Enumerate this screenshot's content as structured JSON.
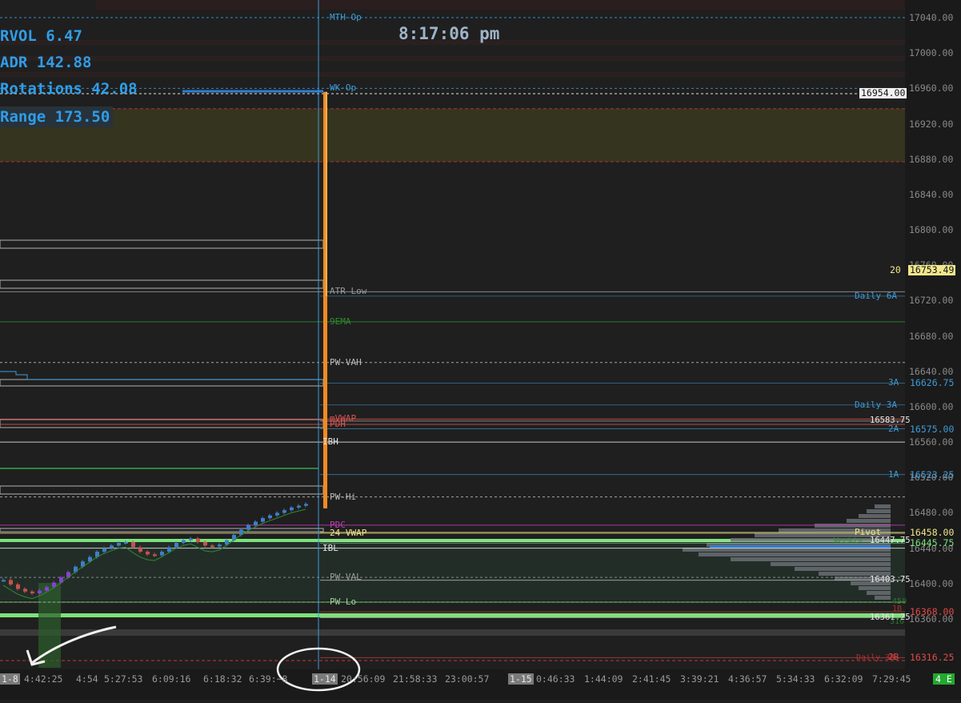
{
  "clock": "8:17:06 pm",
  "stats": [
    "RVOL 6.47",
    "ADR 142.88",
    "Rotations 42.08",
    "Range 173.50"
  ],
  "chart_data": {
    "type": "candlestick",
    "ylim": [
      16300,
      17060
    ],
    "y_ticks": [
      17040,
      17000,
      16960,
      16920,
      16880,
      16840,
      16800,
      16760,
      16720,
      16680,
      16640,
      16600,
      16560,
      16520,
      16480,
      16440,
      16400,
      16360
    ],
    "y_tick_labels": [
      "17040.00",
      "17000.00",
      "16960.00",
      "16920.00",
      "16880.00",
      "16840.00",
      "16800.00",
      "16760.00",
      "16720.00",
      "16680.00",
      "16640.00",
      "16600.00",
      "16560.00",
      "16520.00",
      "16480.00",
      "16440.00",
      "16400.00",
      "16360.00"
    ],
    "x_labels": [
      "1-8",
      "4:42:25",
      "4:54",
      "5:27:53",
      "6:09:16",
      "6:18:32",
      "6:39:~8",
      "1-14",
      "20:56:09",
      "21:58:33",
      "23:00:57",
      "1-15",
      "0:46:33",
      "1:44:09",
      "2:41:45",
      "3:39:21",
      "4:36:57",
      "5:34:33",
      "6:32:09",
      "7:29:45"
    ],
    "x_label_is_date": [
      true,
      false,
      false,
      false,
      false,
      false,
      false,
      true,
      false,
      false,
      false,
      true,
      false,
      false,
      false,
      false,
      false,
      false,
      false,
      false
    ],
    "price_closes": [
      16404,
      16399,
      16394,
      16391,
      16389,
      16392,
      16396,
      16401,
      16407,
      16413,
      16419,
      16425,
      16430,
      16436,
      16440,
      16443,
      16446,
      16447,
      16441,
      16436,
      16433,
      16432,
      16436,
      16441,
      16446,
      16449,
      16451,
      16447,
      16443,
      16442,
      16444,
      16449,
      16455,
      16461,
      16466,
      16470,
      16474,
      16477,
      16480,
      16483,
      16486,
      16488,
      16490
    ],
    "spike": {
      "low": 16485,
      "high": 16956,
      "close": 16725
    },
    "current_price_label": "16954.00",
    "sma_label": "20",
    "sma_value_label": "16753.49",
    "high_zone": [
      16877,
      16937
    ],
    "value_zone": [
      16381,
      16448
    ],
    "levels": [
      {
        "name": "MTH-Op",
        "price": 17040,
        "color": "#3d9bd8",
        "dash": true
      },
      {
        "name": "WK-Op",
        "price": 16960,
        "color": "#3d9bd8",
        "dash": true
      },
      {
        "name": "ATR Low",
        "price": 16730,
        "color": "#9a9a9a",
        "dash": false
      },
      {
        "name": "9EMA",
        "price": 16696,
        "color": "#2e8b2e",
        "dash": false
      },
      {
        "name": "PW-VAH",
        "price": 16650,
        "color": "#bdbdbd",
        "dash": true
      },
      {
        "name": "mVWAP",
        "price": 16586,
        "color": "#d9534f",
        "dash": false
      },
      {
        "name": "PDH",
        "price": 16580,
        "color": "#d9534f",
        "dash": false
      },
      {
        "name": "IBH",
        "price": 16560,
        "color": "#e6e6e6",
        "dash": false
      },
      {
        "name": "PW-Hi",
        "price": 16498,
        "color": "#bdbdbd",
        "dash": true
      },
      {
        "name": "PDC",
        "price": 16466,
        "color": "#c23cb8",
        "dash": false
      },
      {
        "name": "24 VWAP",
        "price": 16457,
        "color": "#f0e68c",
        "dash": false
      },
      {
        "name": "IBL",
        "price": 16440,
        "color": "#e6e6e6",
        "dash": false
      },
      {
        "name": "PW-VAL",
        "price": 16407,
        "color": "#9a9a9a",
        "dash": true
      },
      {
        "name": "PW-Lo",
        "price": 16379,
        "color": "#9bd19b",
        "dash": true
      }
    ],
    "right_levels": [
      {
        "label": "Daily 6A",
        "value": "",
        "price": 16725,
        "color": "#3d9bd8"
      },
      {
        "label": "3A",
        "value": "16626.75",
        "price": 16626.75,
        "color": "#3d9bd8"
      },
      {
        "label": "Daily 3A",
        "value": "",
        "price": 16602,
        "color": "#3d9bd8"
      },
      {
        "label": "",
        "value": "16583.75",
        "price": 16583.75,
        "color": "#e6e6e6"
      },
      {
        "label": "2A",
        "value": "16575.00",
        "price": 16575,
        "color": "#3d9bd8"
      },
      {
        "label": "1A",
        "value": "16523.25",
        "price": 16523.25,
        "color": "#3d9bd8"
      },
      {
        "label": "Pivot",
        "value": "16458.00",
        "price": 16458,
        "color": "#f0e68c"
      },
      {
        "label": "",
        "value": "16447.75",
        "price": 16447.75,
        "color": "#e6e6e6"
      },
      {
        "label": "",
        "value": "16445.75",
        "price": 16445.75,
        "color": "#7be27b"
      },
      {
        "label": "",
        "value": "16403.75",
        "price": 16403.75,
        "color": "#e6e6e6"
      },
      {
        "label": "",
        "value": "16368.00",
        "price": 16368,
        "color": "#e34a4a"
      },
      {
        "label": "",
        "value": "16361.25",
        "price": 16361.25,
        "color": "#e6e6e6"
      },
      {
        "label": "2B",
        "value": "16316.25",
        "price": 16316.25,
        "color": "#e34a4a"
      }
    ],
    "right_level_fragments": [
      "Weekly",
      "Daily 3B",
      "450",
      "1B",
      "316"
    ],
    "bottom_right_badge": "4 E"
  }
}
